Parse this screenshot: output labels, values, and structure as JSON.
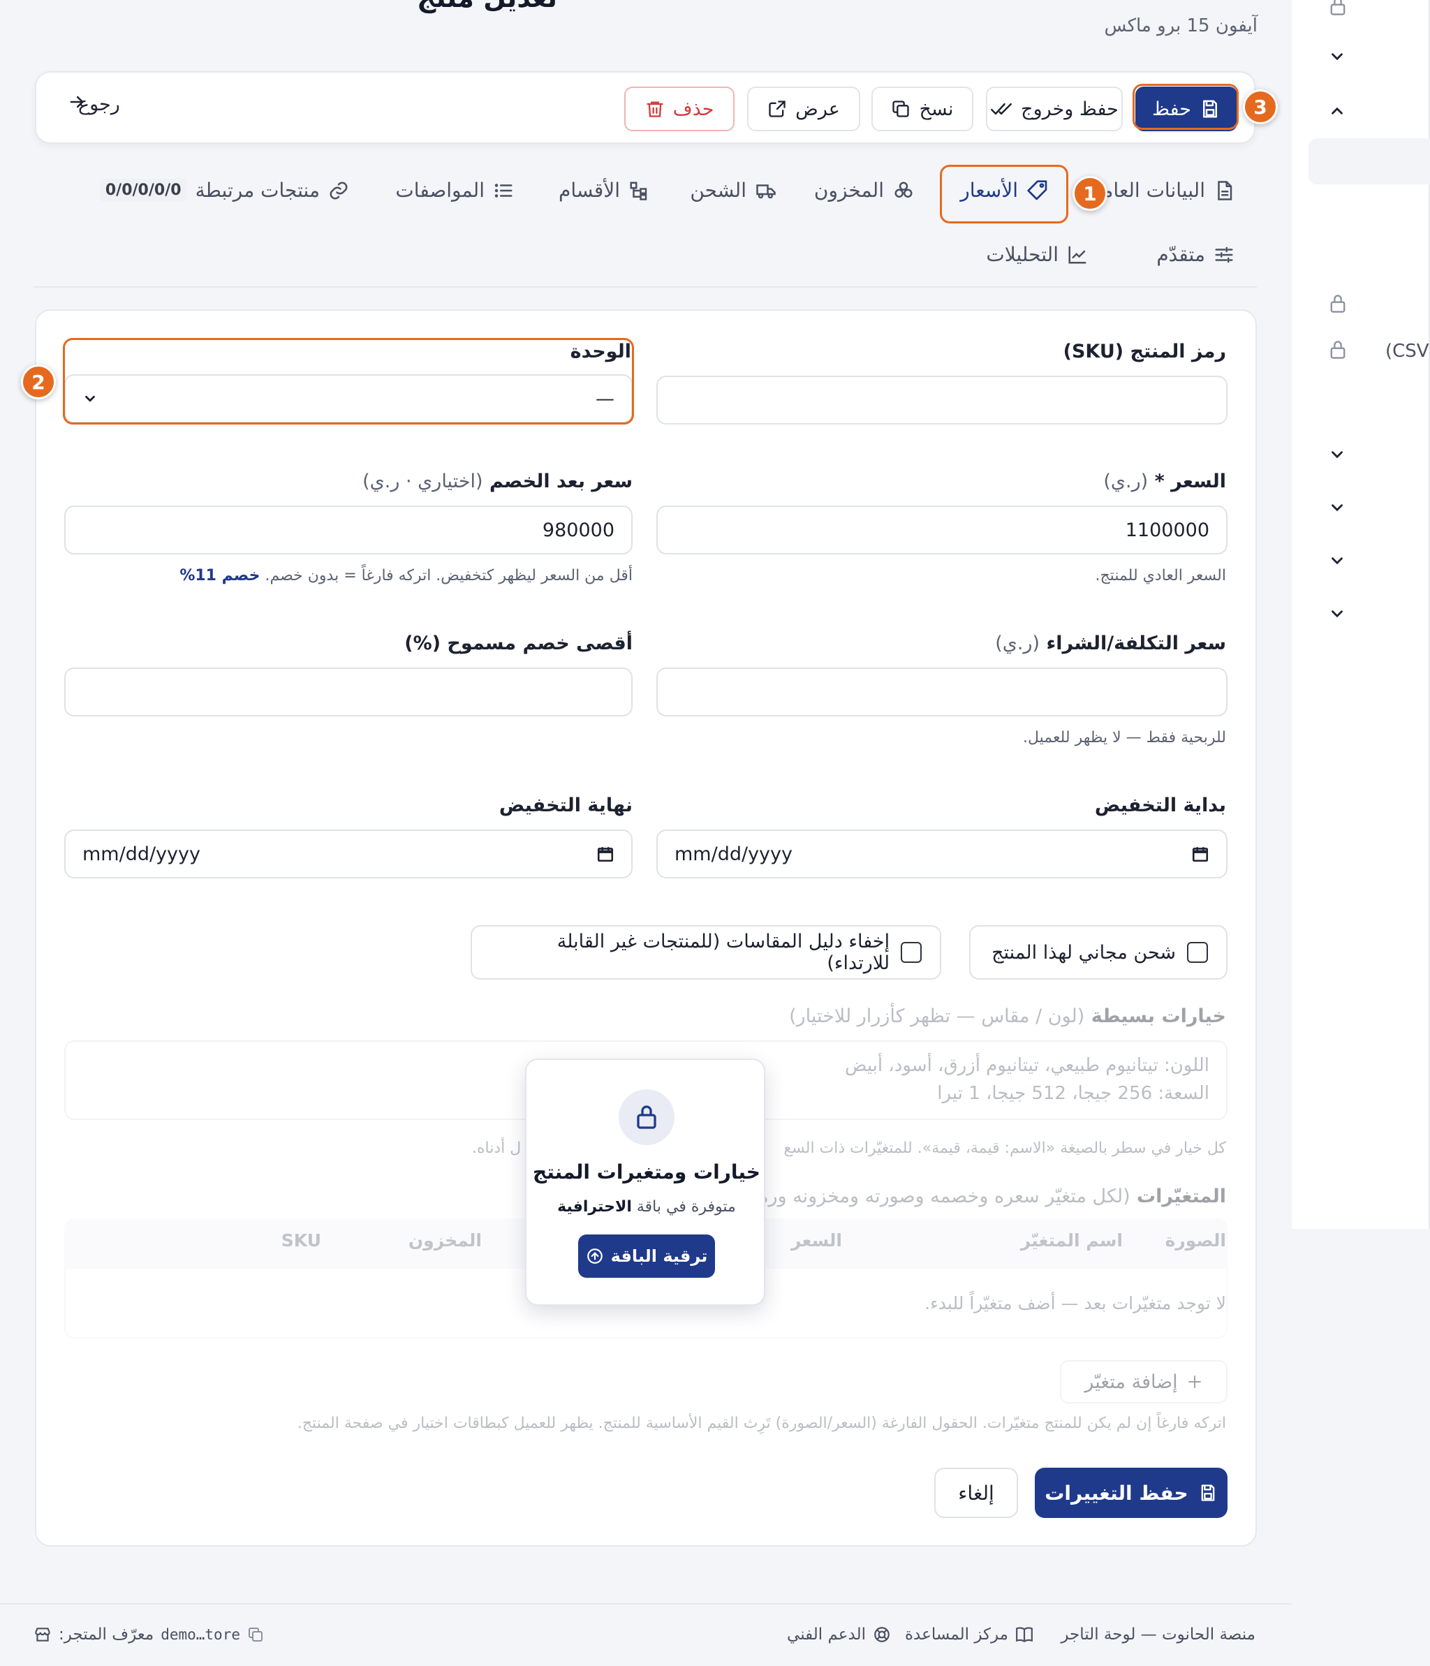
{
  "header": {
    "title": "تعديل منتج",
    "subtitle": "آيفون 15 برو ماكس"
  },
  "toolbar": {
    "save": "حفظ",
    "save_exit": "حفظ وخروج",
    "copy": "نسخ",
    "view": "عرض",
    "delete": "حذف",
    "back": "رجوع"
  },
  "badges": [
    "1",
    "2",
    "3"
  ],
  "tabs": [
    {
      "label": "البيانات العامة",
      "icon": "document-icon"
    },
    {
      "label": "الأسعار",
      "icon": "tag-icon",
      "active": true
    },
    {
      "label": "المخزون",
      "icon": "boxes-icon"
    },
    {
      "label": "الشحن",
      "icon": "truck-icon"
    },
    {
      "label": "الأقسام",
      "icon": "category-tree-icon"
    },
    {
      "label": "المواصفات",
      "icon": "list-icon"
    },
    {
      "label": "منتجات مرتبطة",
      "icon": "link-icon",
      "pill": "0/0/0/0/0"
    },
    {
      "label": "متقدّم",
      "icon": "sliders-icon"
    },
    {
      "label": "التحليلات",
      "icon": "chart-icon"
    }
  ],
  "form": {
    "sku_label": "رمز المنتج (SKU)",
    "sku_value": "",
    "unit_label": "الوحدة",
    "unit_value": "—",
    "price_label": "السعر *",
    "price_unit": "(ر.ي)",
    "price_value": "1100000",
    "price_hint": "السعر العادي للمنتج.",
    "sale_label": "سعر بعد الخصم",
    "sale_muted": "(اختياري · ر.ي)",
    "sale_value": "980000",
    "sale_hint": "أقل من السعر ليظهر كتخفيض. اتركه فارغاً = بدون خصم.",
    "sale_discount": "خصم 11%",
    "cost_label": "سعر التكلفة/الشراء",
    "cost_unit": "(ر.ي)",
    "cost_value": "",
    "cost_hint": "للربحية فقط — لا يظهر للعميل.",
    "maxdisc_label": "أقصى خصم مسموح (%)",
    "maxdisc_value": "",
    "start_label": "بداية التخفيض",
    "start_value": "mm/dd/yyyy",
    "end_label": "نهاية التخفيض",
    "end_value": "mm/dd/yyyy",
    "free_shipping": "شحن مجاني لهذا المنتج",
    "hide_size_guide": "إخفاء دليل المقاسات (للمنتجات غير القابلة للارتداء)",
    "simple_options_label": "خيارات بسيطة",
    "simple_options_muted": "(لون / مقاس — تظهر كأزرار للاختيار)",
    "simple_options_line1": "اللون: تيتانيوم طبيعي، تيتانيوم أزرق، أسود، أبيض",
    "simple_options_line2": "السعة: 256 جيجا، 512 جيجا، 1 تيرا",
    "simple_options_hint_right": "كل خيار في سطر بالصيغة «الاسم: قيمة، قيمة». للمتغيّرات ذات السع",
    "simple_options_hint_left": "ل أدناه.",
    "variants_label": "المتغيّرات",
    "variants_muted": "(لكل متغيّر سعره وخصمه وصورته ومخزونه ورمز",
    "table_headers": [
      "الصورة",
      "اسم المتغيّر",
      "السعر",
      "المخزون",
      "SKU"
    ],
    "table_empty": "لا توجد متغيّرات بعد — أضف متغيّراً للبدء.",
    "add_variant": "إضافة متغيّر",
    "variants_hint": "اتركه فارغاً إن لم يكن للمنتج متغيّرات. الحقول الفارغة (السعر/الصورة) تَرِث القيم الأساسية للمنتج. يظهر للعميل كبطاقات اختيار في صفحة المنتج.",
    "save_changes": "حفظ التغييرات",
    "cancel": "إلغاء"
  },
  "lock_popup": {
    "title": "خيارات ومتغيرات المنتج",
    "subtitle_prefix": "متوفرة في باقة",
    "subtitle_plan": "الاحترافية",
    "button": "ترقية الباقة"
  },
  "sidebar": {
    "csv_label": "(CSV)"
  },
  "footer": {
    "platform": "منصة الحانوت — لوحة التاجر",
    "help": "مركز المساعدة",
    "support": "الدعم الفني",
    "store_id_label": "معرّف المتجر:",
    "store_id": "demo…tore"
  },
  "colors": {
    "primary": "#1f3a8a",
    "highlight": "#e56a1f",
    "danger": "#d33a3a"
  }
}
